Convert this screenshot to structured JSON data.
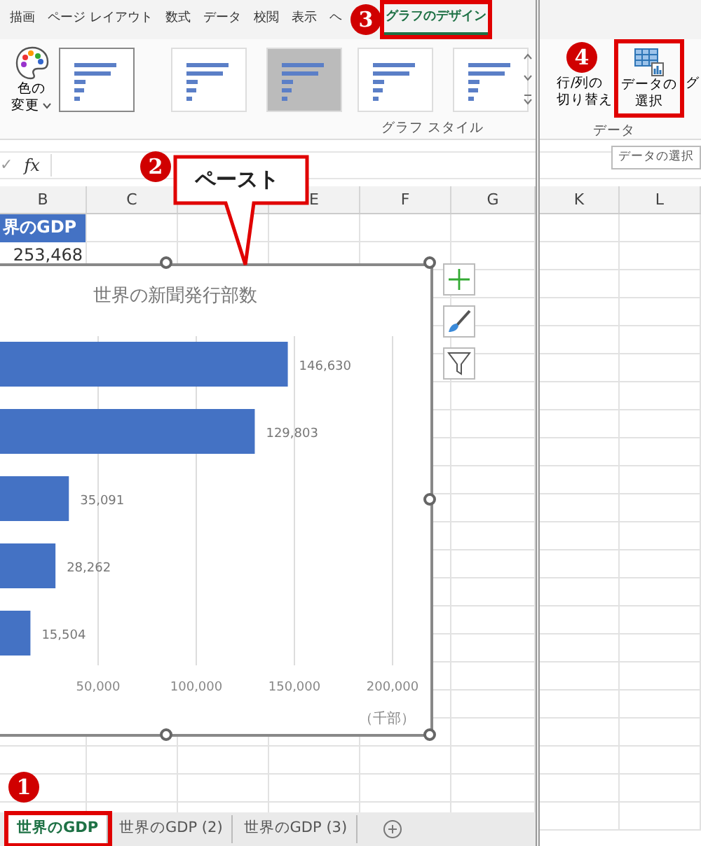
{
  "ribbon_tabs": [
    {
      "label": "描画",
      "selected": false
    },
    {
      "label": "ページ レイアウト",
      "selected": false
    },
    {
      "label": "数式",
      "selected": false
    },
    {
      "label": "データ",
      "selected": false
    },
    {
      "label": "校閲",
      "selected": false
    },
    {
      "label": "表示",
      "selected": false
    },
    {
      "label": "ヘ",
      "selected": false
    },
    {
      "label": "グラフのデザイン",
      "selected": true
    }
  ],
  "ribbon": {
    "color_button": [
      "色の",
      "変更"
    ],
    "chart_styles": [
      {
        "kind": "plain",
        "selected": true
      },
      {
        "kind": "plain",
        "selected": false
      },
      {
        "kind": "shaded",
        "selected": false
      },
      {
        "kind": "plain",
        "selected": false
      },
      {
        "kind": "plain",
        "selected": false
      }
    ],
    "style_group_label": "グラフ スタイル",
    "switch_button": [
      "行/列の",
      "切り替え"
    ],
    "select_data_button": [
      "データの",
      "選択"
    ],
    "next_button": "グ",
    "data_group_label": "データ",
    "tooltip": "データの選択"
  },
  "formula_bar": {
    "enter": "✓",
    "function": "fx"
  },
  "columns_left": [
    "B",
    "C"
  ],
  "columns_left_after_callout": [
    "E",
    "F",
    "G"
  ],
  "columns_right": [
    "K",
    "L"
  ],
  "cells": [
    {
      "kind": "header",
      "text": "界のGDP"
    },
    {
      "kind": "number",
      "text": "253,468"
    }
  ],
  "chart": {
    "chart_data": {
      "type": "bar",
      "orientation": "horizontal",
      "title": "世界の新聞発行部数",
      "xlabel": "（千部）",
      "values": [
        146630,
        129803,
        35091,
        28262,
        15504
      ],
      "value_labels": [
        "146,630",
        "129,803",
        "35,091",
        "28,262",
        "15,504"
      ],
      "xlim": [
        0,
        200000
      ],
      "grid": true,
      "xticks": [
        {
          "value": 50000,
          "label": "50,000"
        },
        {
          "value": 100000,
          "label": "100,000"
        },
        {
          "value": 150000,
          "label": "150,000"
        },
        {
          "value": 200000,
          "label": "200,000"
        }
      ]
    }
  },
  "callout": "ペースト",
  "step_markers": [
    "1",
    "2",
    "3",
    "4"
  ],
  "sheet_tabs": [
    {
      "label": "世界のGDP",
      "selected": true
    },
    {
      "label": "世界のGDP (2)",
      "selected": false
    },
    {
      "label": "世界のGDP (3)",
      "selected": false
    }
  ]
}
